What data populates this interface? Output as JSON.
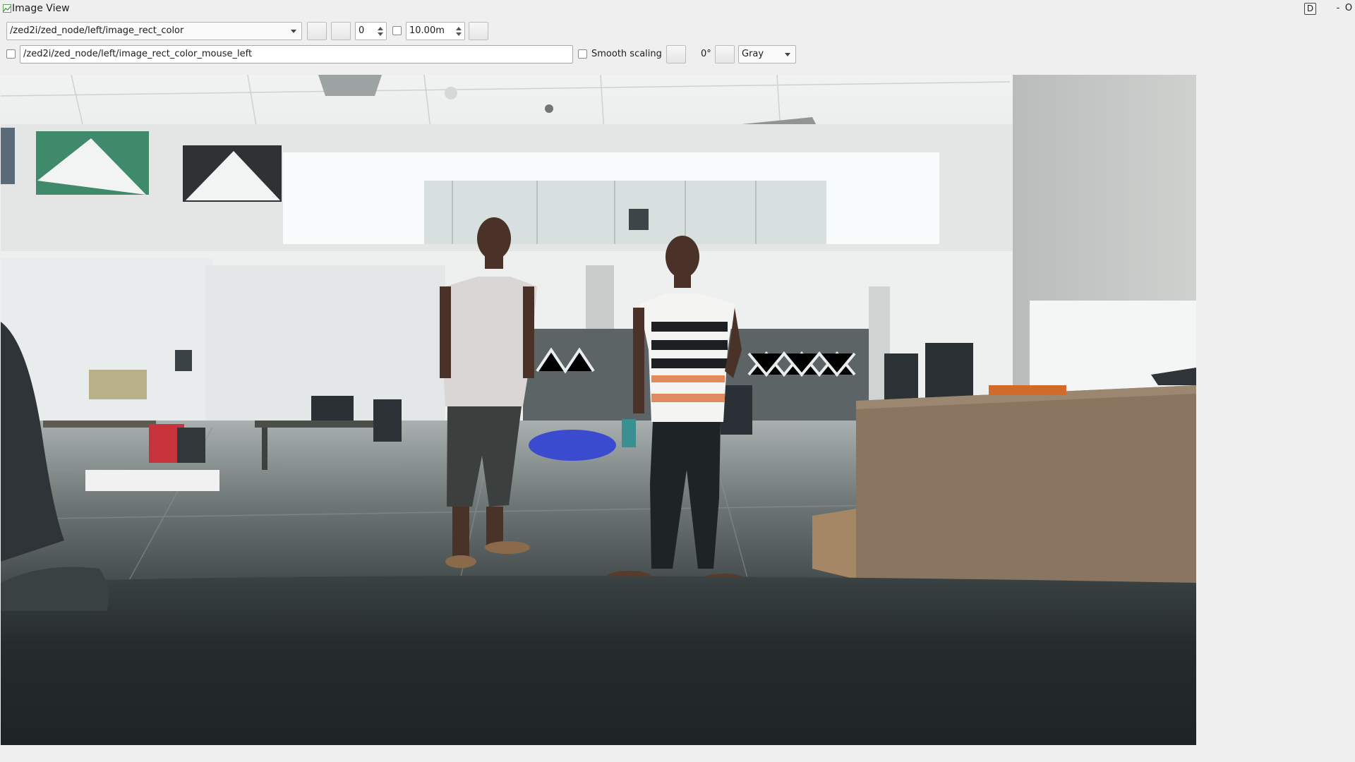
{
  "window": {
    "title": "Image View",
    "d_button_label": "D",
    "minimize_label": "-",
    "close_label": "O"
  },
  "toolbar": {
    "topic_combo_value": "/zed2i/zed_node/left/image_rect_color",
    "min_value": "0",
    "max_value": "10.00m",
    "mouse_topic_value": "/zed2i/zed_node/left/image_rect_color_mouse_left",
    "smooth_scaling_label": "Smooth scaling",
    "rotation_label": "0°",
    "colormap_value": "Gray"
  },
  "colors": {
    "background": "#efefef",
    "ceiling": "#e8eaea",
    "floor": "#6f7676",
    "foreground_dark": "#22272a"
  }
}
